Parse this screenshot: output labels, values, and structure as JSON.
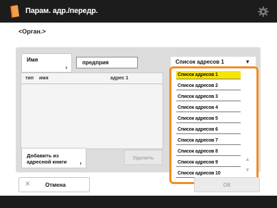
{
  "header": {
    "title": "Парам. адр./передр."
  },
  "subheader": {
    "title": "<Орган.>"
  },
  "form": {
    "name_button_label": "Имя",
    "name_value": "предприя",
    "address_list_selected": "Список адресов 1",
    "table_columns": [
      "тип",
      "имя",
      "адрес 1"
    ],
    "add_from_book_label": "Добавить из\nадресной книги",
    "delete_label": "Удалить"
  },
  "dropdown": {
    "items": [
      "Список адресов 1",
      "Список адресов 2",
      "Список адресов 3",
      "Список адресов 4",
      "Список адресов 5",
      "Список адресов 6",
      "Список адресов 7",
      "Список адресов 8",
      "Список адресов 9",
      "Список адресов 10"
    ],
    "selected_index": 0
  },
  "footer": {
    "cancel_label": "Отмена",
    "ok_label": "ОК"
  },
  "colors": {
    "accent": "#f28c1b",
    "highlight": "#f7e400",
    "titlebar": "#1c1c1c"
  }
}
